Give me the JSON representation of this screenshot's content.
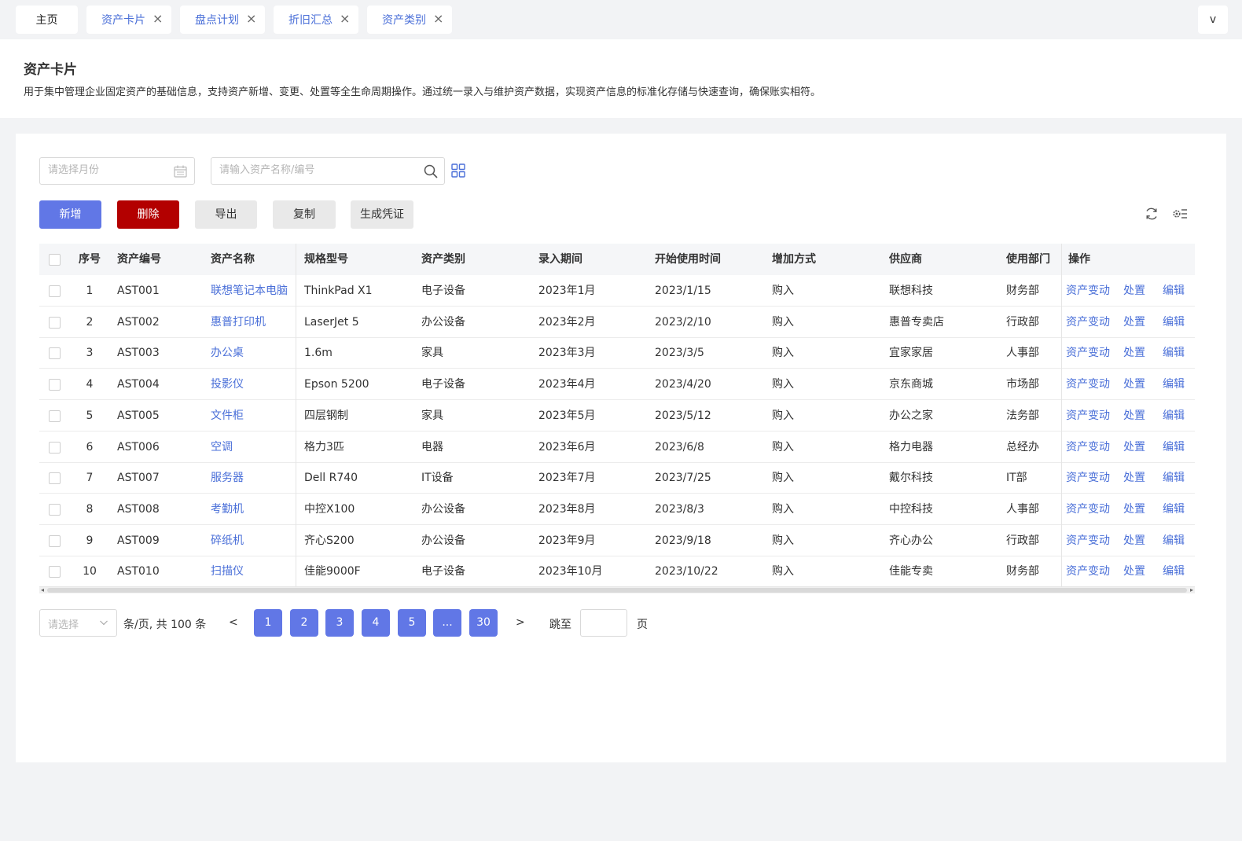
{
  "tabs": [
    {
      "label": "主页",
      "closable": false
    },
    {
      "label": "资产卡片",
      "closable": true
    },
    {
      "label": "盘点计划",
      "closable": true
    },
    {
      "label": "折旧汇总",
      "closable": true
    },
    {
      "label": "资产类别",
      "closable": true
    }
  ],
  "tab_more_label": "v",
  "close_glyph": "×",
  "page": {
    "title": "资产卡片",
    "description": "用于集中管理企业固定资产的基础信息，支持资产新增、变更、处置等全生命周期操作。通过统一录入与维护资产数据，实现资产信息的标准化存储与快速查询，确保账实相符。"
  },
  "filters": {
    "month_placeholder": "请选择月份",
    "search_placeholder": "请输入资产名称/编号"
  },
  "toolbar": {
    "add": "新增",
    "delete": "删除",
    "export": "导出",
    "copy": "复制",
    "voucher": "生成凭证"
  },
  "table": {
    "headers": {
      "seq": "序号",
      "code": "资产编号",
      "name": "资产名称",
      "spec": "规格型号",
      "category": "资产类别",
      "period": "录入期间",
      "start": "开始使用时间",
      "method": "增加方式",
      "supplier": "供应商",
      "dept": "使用部门",
      "ops": "操作"
    },
    "op_labels": {
      "change": "资产变动",
      "dispose": "处置",
      "edit": "编辑"
    },
    "rows": [
      {
        "seq": "1",
        "code": "AST001",
        "name": "联想笔记本电脑",
        "spec": "ThinkPad X1",
        "category": "电子设备",
        "period": "2023年1月",
        "start": "2023/1/15",
        "method": "购入",
        "supplier": "联想科技",
        "dept": "财务部"
      },
      {
        "seq": "2",
        "code": "AST002",
        "name": "惠普打印机",
        "spec": "LaserJet 5",
        "category": "办公设备",
        "period": "2023年2月",
        "start": "2023/2/10",
        "method": "购入",
        "supplier": "惠普专卖店",
        "dept": "行政部"
      },
      {
        "seq": "3",
        "code": "AST003",
        "name": "办公桌",
        "spec": "1.6m",
        "category": "家具",
        "period": "2023年3月",
        "start": "2023/3/5",
        "method": "购入",
        "supplier": "宜家家居",
        "dept": "人事部"
      },
      {
        "seq": "4",
        "code": "AST004",
        "name": "投影仪",
        "spec": "Epson 5200",
        "category": "电子设备",
        "period": "2023年4月",
        "start": "2023/4/20",
        "method": "购入",
        "supplier": "京东商城",
        "dept": "市场部"
      },
      {
        "seq": "5",
        "code": "AST005",
        "name": "文件柜",
        "spec": "四层钢制",
        "category": "家具",
        "period": "2023年5月",
        "start": "2023/5/12",
        "method": "购入",
        "supplier": "办公之家",
        "dept": "法务部"
      },
      {
        "seq": "6",
        "code": "AST006",
        "name": "空调",
        "spec": "格力3匹",
        "category": "电器",
        "period": "2023年6月",
        "start": "2023/6/8",
        "method": "购入",
        "supplier": "格力电器",
        "dept": "总经办"
      },
      {
        "seq": "7",
        "code": "AST007",
        "name": "服务器",
        "spec": "Dell R740",
        "category": "IT设备",
        "period": "2023年7月",
        "start": "2023/7/25",
        "method": "购入",
        "supplier": "戴尔科技",
        "dept": "IT部"
      },
      {
        "seq": "8",
        "code": "AST008",
        "name": "考勤机",
        "spec": "中控X100",
        "category": "办公设备",
        "period": "2023年8月",
        "start": "2023/8/3",
        "method": "购入",
        "supplier": "中控科技",
        "dept": "人事部"
      },
      {
        "seq": "9",
        "code": "AST009",
        "name": "碎纸机",
        "spec": "齐心S200",
        "category": "办公设备",
        "period": "2023年9月",
        "start": "2023/9/18",
        "method": "购入",
        "supplier": "齐心办公",
        "dept": "行政部"
      },
      {
        "seq": "10",
        "code": "AST010",
        "name": "扫描仪",
        "spec": "佳能9000F",
        "category": "电子设备",
        "period": "2023年10月",
        "start": "2023/10/22",
        "method": "购入",
        "supplier": "佳能专卖",
        "dept": "财务部"
      }
    ]
  },
  "pagination": {
    "size_placeholder": "请选择",
    "total_text": "条/页, 共 100 条",
    "prev": "<",
    "next": ">",
    "pages": [
      "1",
      "2",
      "3",
      "4",
      "5",
      "...",
      "30"
    ],
    "jump_label": "跳至",
    "page_unit": "页"
  },
  "colors": {
    "primary": "#6177e6",
    "danger": "#b30000",
    "link": "#4a6fd8"
  }
}
